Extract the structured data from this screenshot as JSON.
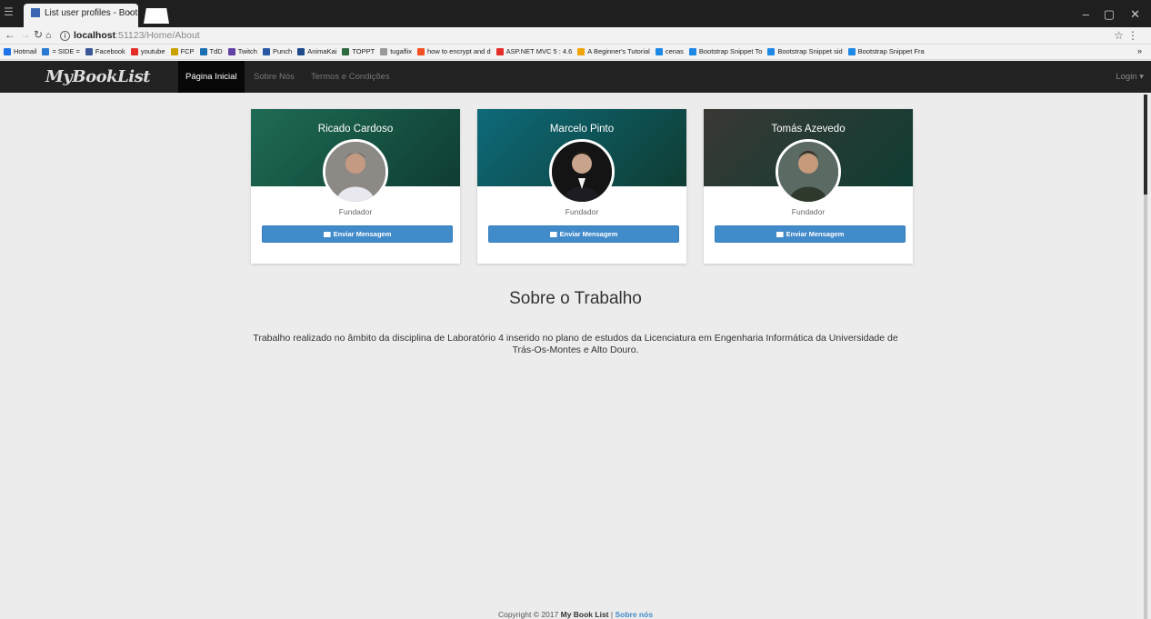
{
  "browser": {
    "tab_title": "List user profiles - Bootst",
    "tab_close": "×",
    "url_host": "localhost",
    "url_path": ":51123/Home/About",
    "bookmarks": [
      {
        "label": "Hotmail",
        "color": "#1a73e8"
      },
      {
        "label": "= SIDE =",
        "color": "#2a7ad1"
      },
      {
        "label": "Facebook",
        "color": "#3b5998"
      },
      {
        "label": "youtube",
        "color": "#e52d27"
      },
      {
        "label": "FCP",
        "color": "#caa200"
      },
      {
        "label": "TdD",
        "color": "#1c6fb0"
      },
      {
        "label": "Twitch",
        "color": "#6441a5"
      },
      {
        "label": "Punch",
        "color": "#2857a4"
      },
      {
        "label": "AnimaKai",
        "color": "#1f4a8a"
      },
      {
        "label": "TOPPT",
        "color": "#2d6a3e"
      },
      {
        "label": "tugaflix",
        "color": "#999999"
      },
      {
        "label": "how to encrypt and d",
        "color": "#f25022"
      },
      {
        "label": "ASP.NET MVC 5 : 4.6",
        "color": "#e52d27"
      },
      {
        "label": "A Beginner's Tutorial",
        "color": "#f0a30a"
      },
      {
        "label": "cenas",
        "color": "#1e88e5"
      },
      {
        "label": "Bootstrap Snippet To",
        "color": "#1e88e5"
      },
      {
        "label": "Bootstrap Snippet sid",
        "color": "#1e88e5"
      },
      {
        "label": "Bootstrap Snippet Fra",
        "color": "#1e88e5"
      }
    ],
    "bookmarks_more": "»"
  },
  "navbar": {
    "brand": "MyBookList",
    "links": [
      "Página Inicial",
      "Sobre Nós",
      "Termos e Condições"
    ],
    "login": "Login ▾"
  },
  "cards": [
    {
      "name": "Ricado Cardoso",
      "role": "Fundador",
      "button": "Enviar Mensagem",
      "cover_color": "#1f6b55"
    },
    {
      "name": "Marcelo Pinto",
      "role": "Fundador",
      "button": "Enviar Mensagem",
      "cover_color": "#0e6a7a"
    },
    {
      "name": "Tomás Azevedo",
      "role": "Fundador",
      "button": "Enviar Mensagem",
      "cover_color": "#3a3835"
    }
  ],
  "about": {
    "title": "Sobre o Trabalho",
    "text": "Trabalho realizado no âmbito da disciplina de Laboratório 4 inserido no plano de estudos da Licenciatura em Engenharia Informática da Universidade de Trás-Os-Montes e Alto Douro."
  },
  "footer": {
    "prefix": "Copyright © 2017",
    "site": "My Book List",
    "separator": "|",
    "link": "Sobre nós"
  }
}
